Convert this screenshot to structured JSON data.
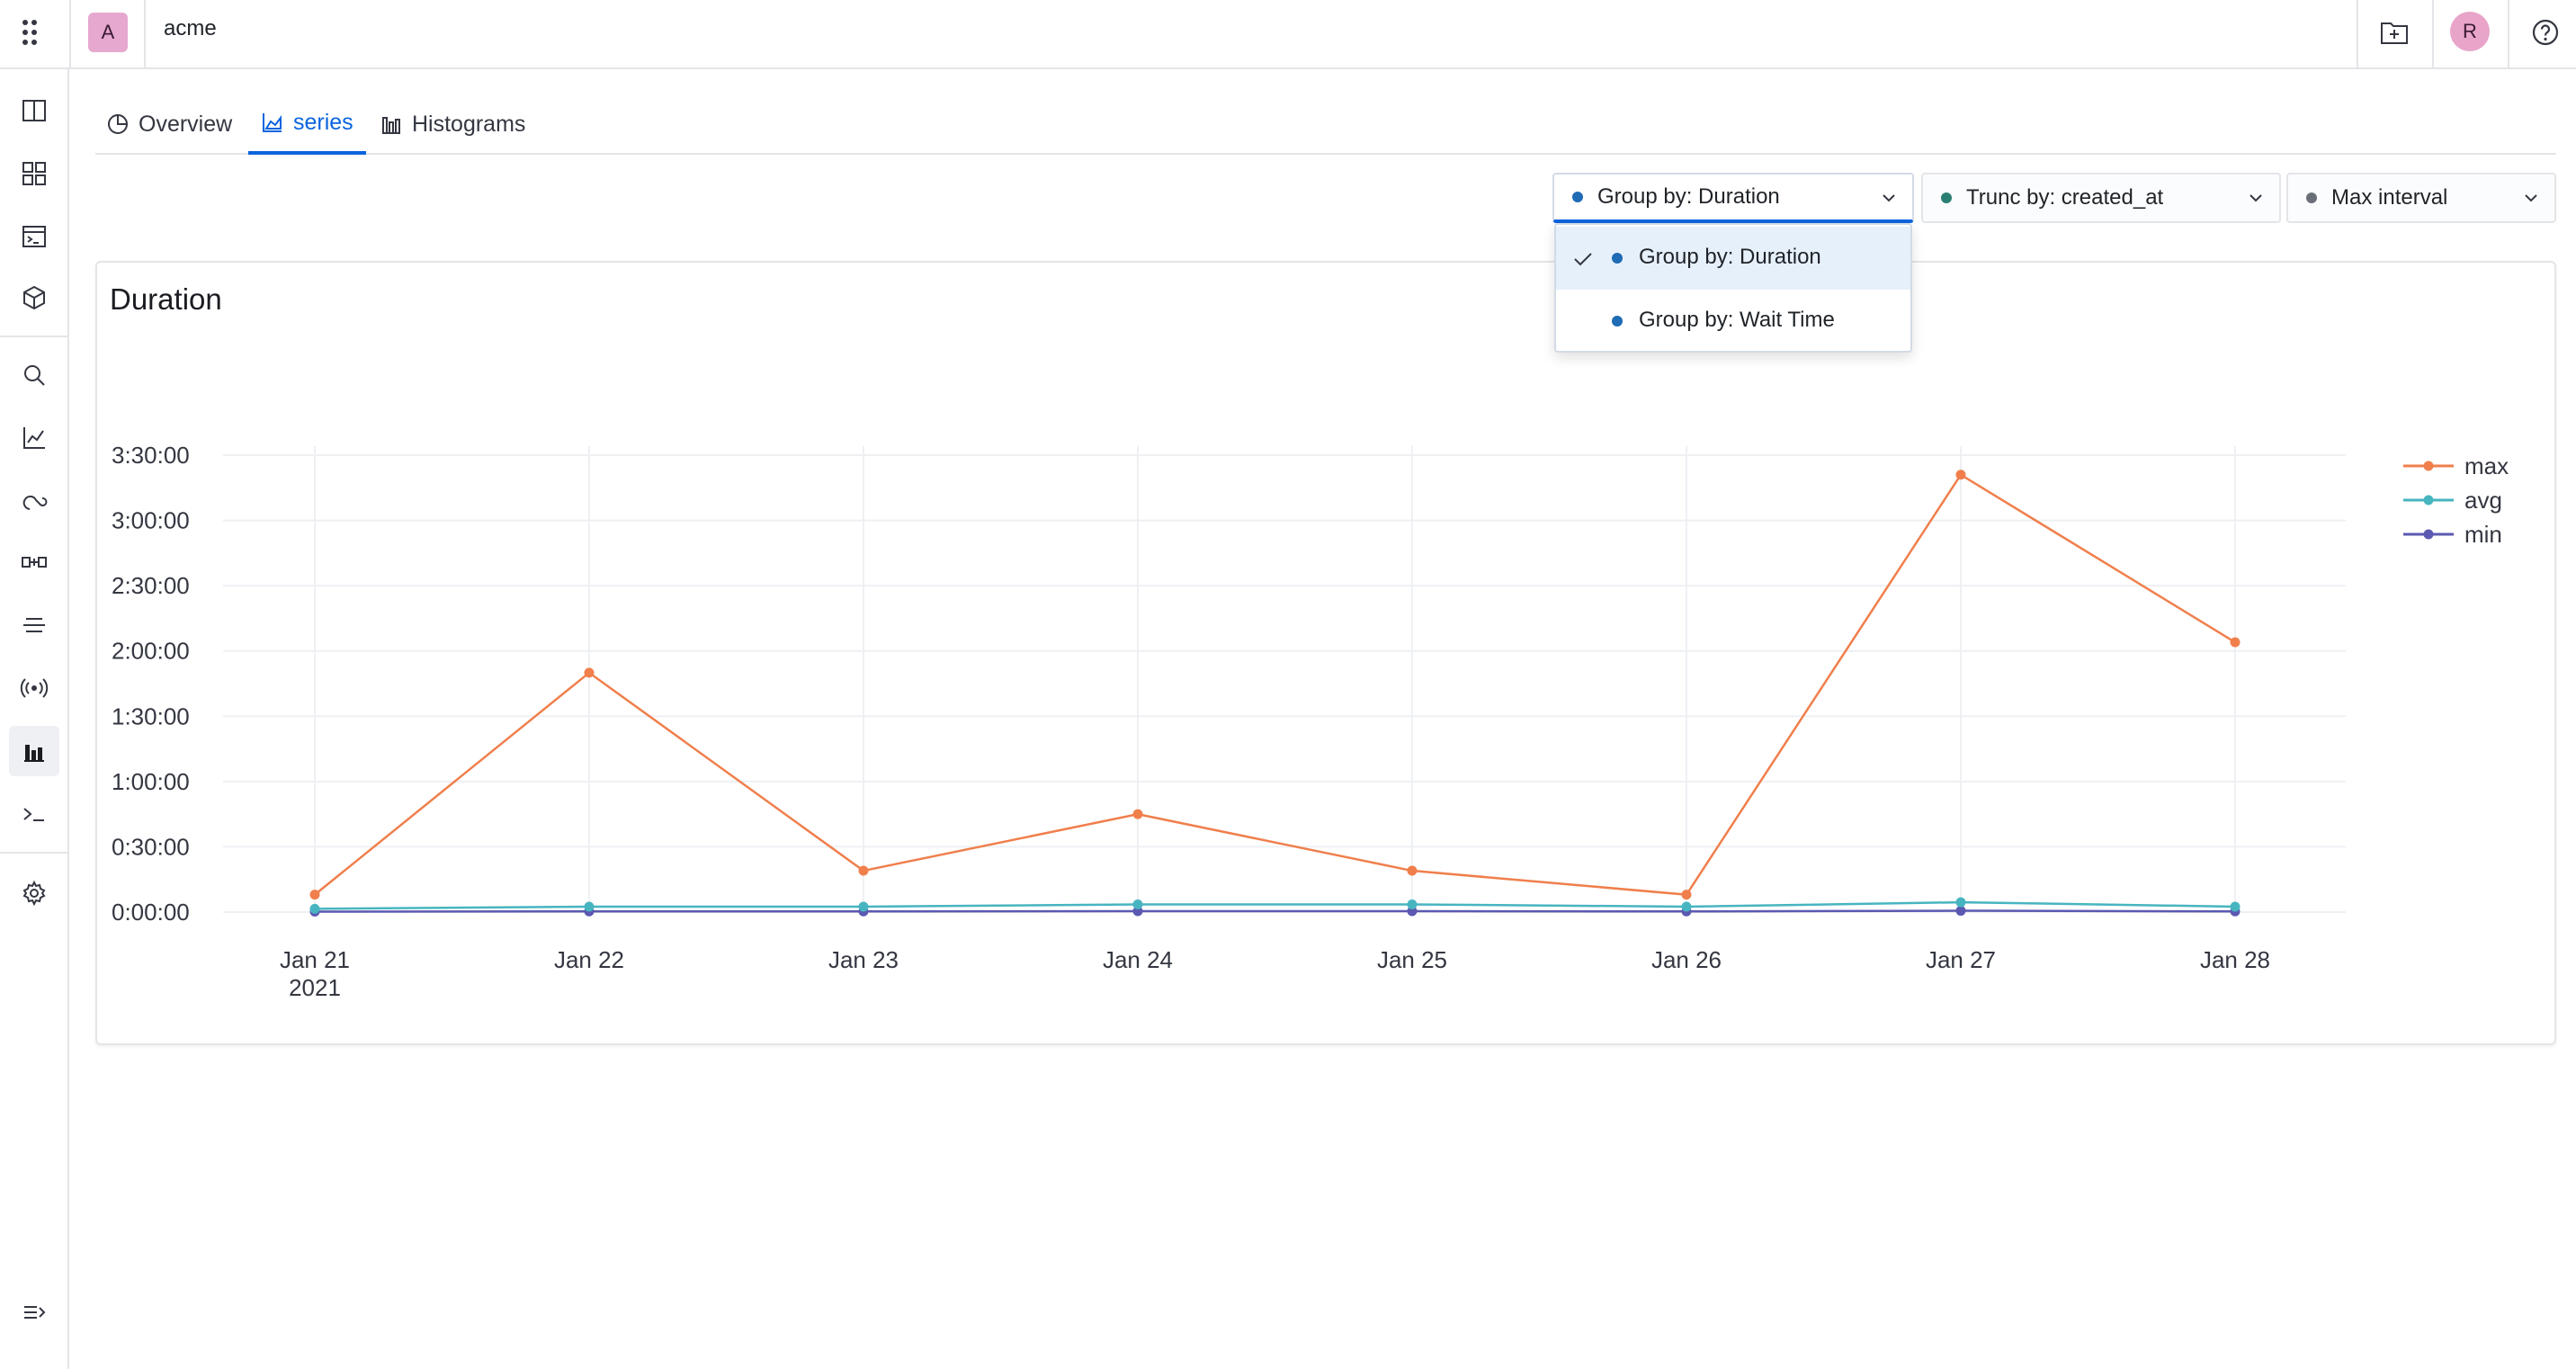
{
  "topbar": {
    "org_avatar": "A",
    "org_name": "acme",
    "user_avatar": "R",
    "icons": [
      "apps-icon",
      "folder-plus-icon",
      "help-icon"
    ]
  },
  "sidenav": {
    "items": [
      {
        "icon": "book-icon"
      },
      {
        "icon": "dashboard-icon"
      },
      {
        "icon": "console-panel-icon"
      },
      {
        "icon": "package-icon"
      },
      {
        "icon": "search-icon"
      },
      {
        "icon": "chart-icon"
      },
      {
        "icon": "hook-icon"
      },
      {
        "icon": "pipeline-icon"
      },
      {
        "icon": "filter-lines-icon"
      },
      {
        "icon": "broadcast-icon"
      },
      {
        "icon": "histogram-icon",
        "active": true
      },
      {
        "icon": "terminal-icon"
      },
      {
        "icon": "settings-icon"
      },
      {
        "icon": "collapse-icon"
      }
    ]
  },
  "tabs": [
    {
      "label": "Overview",
      "icon": "pie-chart-icon"
    },
    {
      "label": "series",
      "icon": "area-chart-icon",
      "active": true
    },
    {
      "label": "Histograms",
      "icon": "bar-chart-icon"
    }
  ],
  "filters": {
    "group_by": {
      "label": "Group by: Duration",
      "dot_color": "#1f6bb5",
      "open": true
    },
    "trunc_by": {
      "label": "Trunc by: created_at",
      "dot_color": "#2a7f72"
    },
    "interval": {
      "label": "Max interval",
      "dot_color": "#6a6f77"
    }
  },
  "dropdown": {
    "options": [
      {
        "label": "Group by: Duration",
        "selected": true,
        "dot_color": "#1f6bb5"
      },
      {
        "label": "Group by: Wait Time",
        "selected": false,
        "dot_color": "#1f6bb5"
      }
    ]
  },
  "chart_data": {
    "type": "line",
    "title": "Duration",
    "x": [
      "Jan 21",
      "Jan 22",
      "Jan 23",
      "Jan 24",
      "Jan 25",
      "Jan 26",
      "Jan 27",
      "Jan 28"
    ],
    "x_year_label": "2021",
    "y_ticks": [
      "0:00:00",
      "0:30:00",
      "1:00:00",
      "1:30:00",
      "2:00:00",
      "2:30:00",
      "3:00:00",
      "3:30:00"
    ],
    "y_unit": "minutes",
    "ylim": [
      0,
      210
    ],
    "grid": true,
    "legend_position": "top-right",
    "series": [
      {
        "name": "max",
        "color": "#f07f4c",
        "values": [
          8,
          110,
          19,
          45,
          19,
          8,
          201,
          124
        ]
      },
      {
        "name": "avg",
        "color": "#47b5c0",
        "values": [
          1.5,
          2.5,
          2.5,
          3.5,
          3.5,
          2.5,
          4.5,
          2.5
        ]
      },
      {
        "name": "min",
        "color": "#5b59b1",
        "values": [
          0.2,
          0.3,
          0.3,
          0.4,
          0.4,
          0.3,
          0.6,
          0.3
        ]
      }
    ]
  }
}
